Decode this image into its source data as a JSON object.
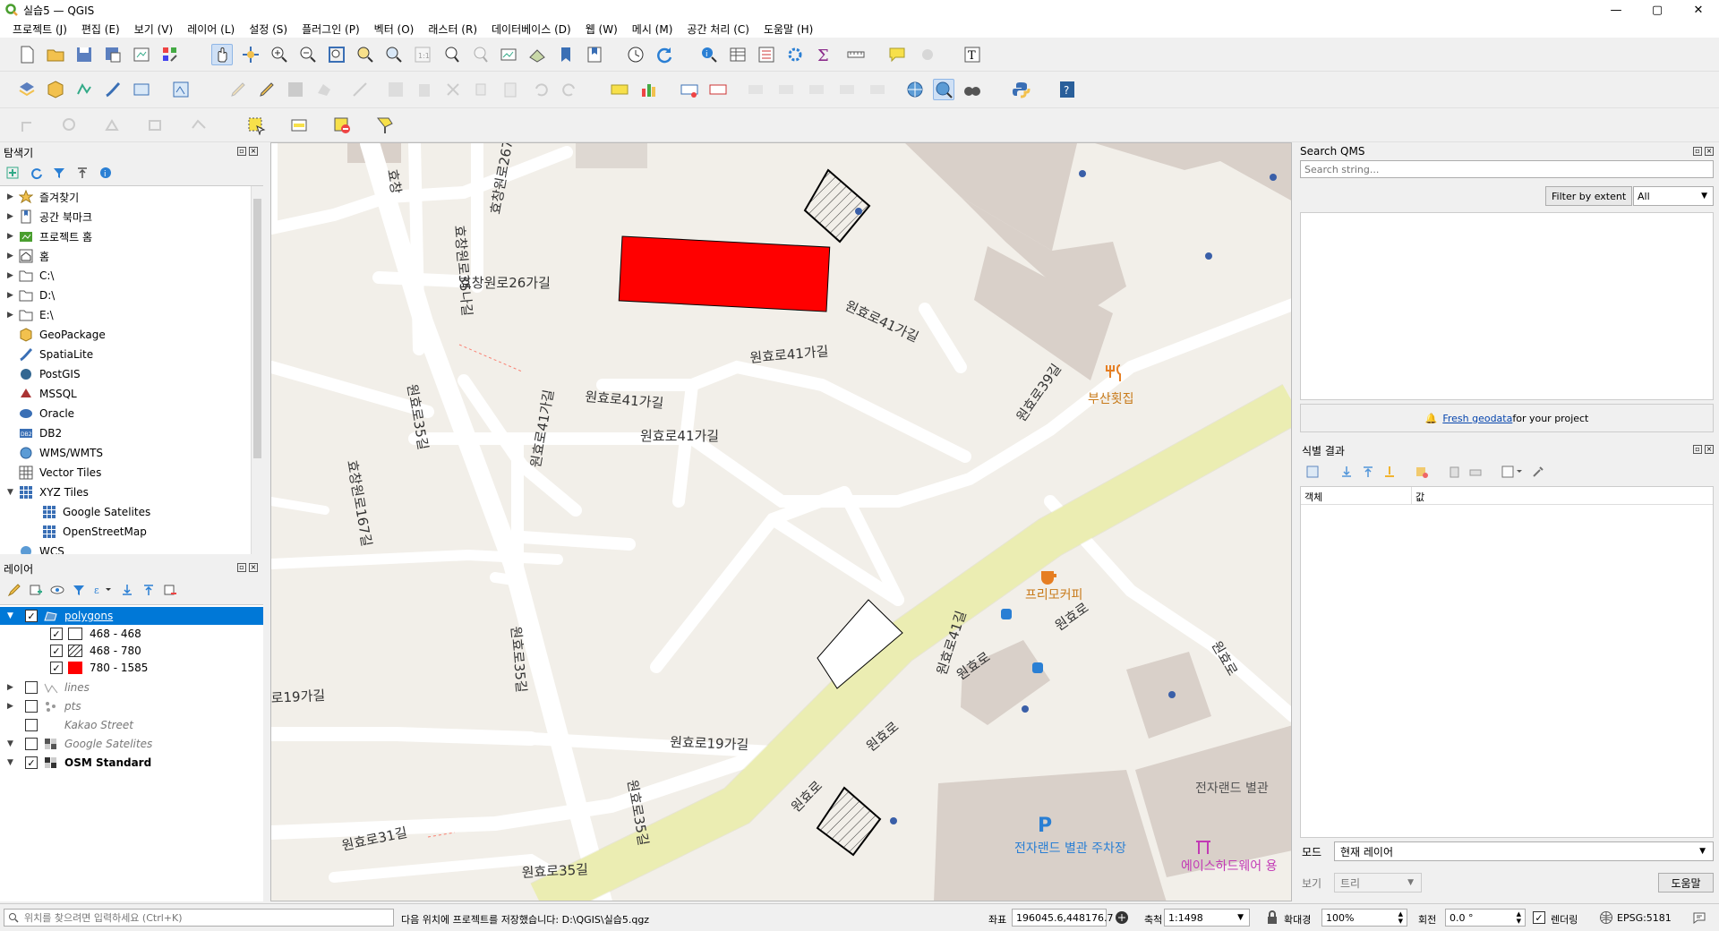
{
  "window": {
    "title": "실습5 — QGIS",
    "minimize": "—",
    "maximize": "▢",
    "close": "✕"
  },
  "menu": [
    "프로젝트 (J)",
    "편집 (E)",
    "보기 (V)",
    "레이어 (L)",
    "설정 (S)",
    "플러그인 (P)",
    "벡터 (O)",
    "래스터 (R)",
    "데이터베이스 (D)",
    "웹 (W)",
    "메시 (M)",
    "공간 처리 (C)",
    "도움말 (H)"
  ],
  "browser": {
    "title": "탐색기",
    "items": [
      {
        "label": "즐겨찾기",
        "icon": "star-icon",
        "expand": true
      },
      {
        "label": "공간 북마크",
        "icon": "bookmark-icon",
        "expand": true
      },
      {
        "label": "프로젝트 홈",
        "icon": "project-home-icon",
        "expand": true
      },
      {
        "label": "홈",
        "icon": "home-icon",
        "expand": true
      },
      {
        "label": "C:\\",
        "icon": "folder-icon",
        "expand": true
      },
      {
        "label": "D:\\",
        "icon": "folder-icon",
        "expand": true
      },
      {
        "label": "E:\\",
        "icon": "folder-icon",
        "expand": true
      },
      {
        "label": "GeoPackage",
        "icon": "geopackage-icon",
        "expand": false
      },
      {
        "label": "SpatiaLite",
        "icon": "spatialite-icon",
        "expand": false
      },
      {
        "label": "PostGIS",
        "icon": "postgis-icon",
        "expand": false
      },
      {
        "label": "MSSQL",
        "icon": "mssql-icon",
        "expand": false
      },
      {
        "label": "Oracle",
        "icon": "oracle-icon",
        "expand": false
      },
      {
        "label": "DB2",
        "icon": "db2-icon",
        "expand": false
      },
      {
        "label": "WMS/WMTS",
        "icon": "wms-icon",
        "expand": false
      },
      {
        "label": "Vector Tiles",
        "icon": "vector-tiles-icon",
        "expand": false
      },
      {
        "label": "XYZ Tiles",
        "icon": "xyz-tiles-icon",
        "expand": true
      },
      {
        "label": "Google Satelites",
        "icon": "tile-grid-icon",
        "expand": false
      },
      {
        "label": "OpenStreetMap",
        "icon": "tile-grid-icon",
        "expand": false
      },
      {
        "label": "WCS",
        "icon": "wcs-icon",
        "expand": false
      }
    ]
  },
  "layers": {
    "title": "레이어",
    "items": [
      {
        "label": "polygons",
        "checked": true,
        "selected": true,
        "style": "link"
      },
      {
        "label": "468 - 468",
        "checked": true,
        "swatch": "white"
      },
      {
        "label": "468 - 780",
        "checked": true,
        "swatch": "hatch"
      },
      {
        "label": "780 - 1585",
        "checked": true,
        "swatch": "red"
      },
      {
        "label": "lines",
        "checked": false,
        "style": "italic"
      },
      {
        "label": "pts",
        "checked": false,
        "style": "italic"
      },
      {
        "label": "Kakao Street",
        "checked": false,
        "style": "italic"
      },
      {
        "label": "Google Satelites",
        "checked": false,
        "style": "italic"
      },
      {
        "label": "OSM Standard",
        "checked": true,
        "style": "bold"
      }
    ]
  },
  "qms": {
    "title": "Search QMS",
    "placeholder": "Search string...",
    "filter_button": "Filter by extent",
    "filter_select": "All",
    "fresh_link": "Fresh geodata",
    "fresh_text": " for your project"
  },
  "identify": {
    "title": "식별 결과",
    "col_feature": "객체",
    "col_value": "값",
    "mode_label": "모드",
    "mode_value": "현재 레이어",
    "view_label": "보기",
    "view_value": "트리",
    "help_button": "도움말"
  },
  "map": {
    "labels": [
      "효창원로26가길",
      "원효로41가길",
      "원효로41가길",
      "원효로41가길",
      "원효로41가길",
      "원효로41가길",
      "원효로35길",
      "원효로39길",
      "원효로41길",
      "원효로",
      "원효로",
      "원효로",
      "원효로",
      "원효로19가길",
      "로19가길",
      "원효로35길",
      "원효로35길",
      "원효로31길",
      "원효로35길",
      "효창원로35나길",
      "효창원로267",
      "효창원로167길",
      "원효로35길",
      "효창",
      "원효로"
    ],
    "pois": {
      "busan": "부산횟집",
      "cafe": "프리모커피",
      "parking": "전자랜드 별관 주차장",
      "elec": "전자랜드 별관",
      "ace": "에이스하드웨어 용"
    },
    "colors": {
      "background": "#f2efe9",
      "road": "#ffffff",
      "main_road": "#f7fabf",
      "building": "#d9d0c9",
      "red_polygon": "#ff0000"
    }
  },
  "status": {
    "search_placeholder": "위치를 찾으려면 입력하세요 (Ctrl+K)",
    "message": "다음 위치에 프로젝트를 저장했습니다: D:\\QGIS\\실습5.qgz",
    "coord_label": "좌표",
    "coord_value": "196045.6,448176.7",
    "scale_label": "축척",
    "scale_value": "1:1498",
    "magnifier_label": "확대경",
    "magnifier_value": "100%",
    "rotation_label": "회전",
    "rotation_value": "0.0 °",
    "render_label": "렌더링",
    "crs": "EPSG:5181"
  }
}
